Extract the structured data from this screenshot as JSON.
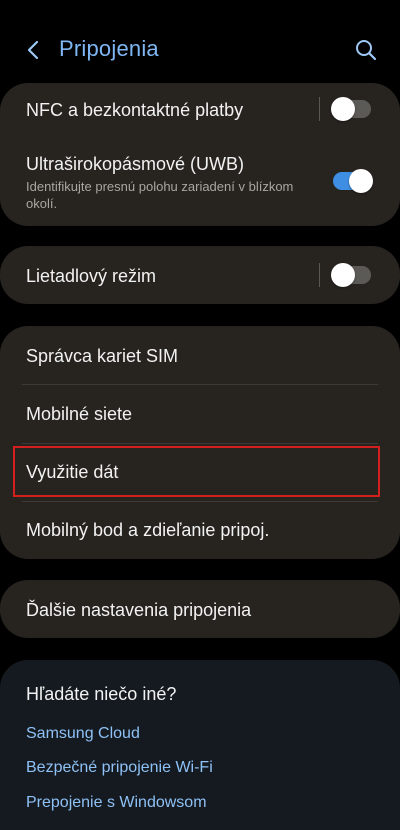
{
  "header": {
    "title": "Pripojenia",
    "back_icon": "chevron-left-icon",
    "search_icon": "search-icon"
  },
  "group1": {
    "nfc": {
      "label": "NFC a bezkontaktné platby",
      "toggle": "off"
    },
    "uwb": {
      "label": "Ultraširokopásmové (UWB)",
      "subtitle": "Identifikujte presnú polohu zariadení v blízkom okolí.",
      "toggle": "on"
    }
  },
  "group2": {
    "airplane": {
      "label": "Lietadlový režim",
      "toggle": "off"
    }
  },
  "group3": {
    "items": [
      {
        "label": "Správca kariet SIM"
      },
      {
        "label": "Mobilné siete"
      },
      {
        "label": "Využitie dát"
      },
      {
        "label": "Mobilný bod a zdieľanie pripoj."
      }
    ]
  },
  "group4": {
    "more": {
      "label": "Ďalšie nastavenia pripojenia"
    }
  },
  "suggestions": {
    "title": "Hľadáte niečo iné?",
    "links": [
      {
        "label": "Samsung Cloud"
      },
      {
        "label": "Bezpečné pripojenie Wi-Fi"
      },
      {
        "label": "Prepojenie s Windowsom"
      }
    ]
  },
  "colors": {
    "background": "#000000",
    "card": "#272420",
    "accent": "#7fb7f4",
    "toggle_on": "#3e8ee3",
    "highlight": "#d41f1f"
  }
}
